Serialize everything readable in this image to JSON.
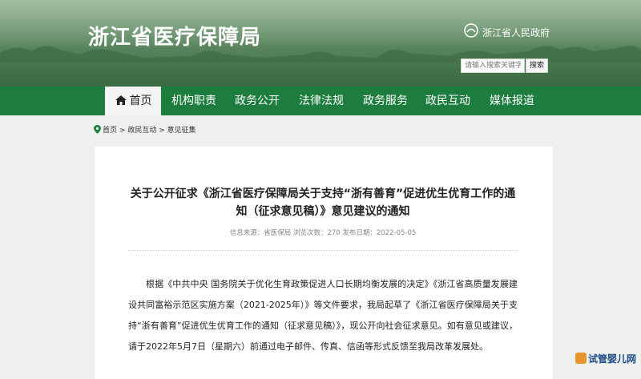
{
  "header": {
    "site_title": "浙江省医疗保障局",
    "gov_link": "浙江省人民政府",
    "search_placeholder": "请输入搜索关键字",
    "search_button": "搜索"
  },
  "nav": {
    "items": [
      {
        "label": "首页",
        "active": true
      },
      {
        "label": "机构职责"
      },
      {
        "label": "政务公开"
      },
      {
        "label": "法律法规"
      },
      {
        "label": "政务服务"
      },
      {
        "label": "政民互动"
      },
      {
        "label": "媒体报道"
      }
    ]
  },
  "breadcrumb": {
    "items": [
      "首页",
      "政民互动",
      "意见征集"
    ],
    "separator": ">"
  },
  "article": {
    "title": "关于公开征求《浙江省医疗保障局关于支持“浙有善育”促进优生优育工作的通知（征求意见稿）》意见建议的通知",
    "meta": "信息来源：省医保局 浏览次数：270 发布日期：2022-05-05",
    "body": "根据《中共中央 国务院关于优化生育政策促进人口长期均衡发展的决定》《浙江省高质量发展建设共同富裕示范区实施方案（2021-2025年）》等文件要求，我局起草了《浙江省医疗保障局关于支持“浙有善育”促进优生优育工作的通知（征求意见稿）》，现公开向社会征求意见。如有意见或建议，请于2022年5月7日（星期六）前通过电子邮件、传真、信函等形式反馈至我局改革发展处。"
  },
  "watermark": "试管婴儿网",
  "colors": {
    "nav_bg": "#1d7d3f",
    "header_green": "#4f7c55",
    "active_tab": "#f4f4f4"
  }
}
